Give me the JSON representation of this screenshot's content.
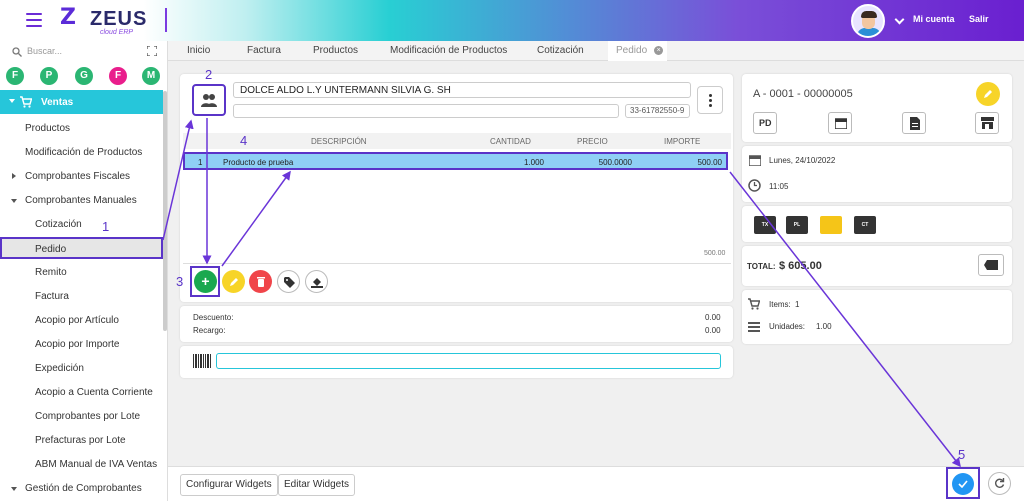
{
  "app": {
    "logo_text": "ZEUS",
    "logo_sub": "cloud ERP",
    "account_label": "Mi cuenta",
    "logout_label": "Salir"
  },
  "sidebar": {
    "search_placeholder": "Buscar...",
    "shortcuts": [
      {
        "letter": "F",
        "color": "#2bb673"
      },
      {
        "letter": "P",
        "color": "#2bb673"
      },
      {
        "letter": "G",
        "color": "#2bb673"
      },
      {
        "letter": "F",
        "color": "#e91e8c"
      },
      {
        "letter": "M",
        "color": "#2bb673"
      }
    ],
    "section_title": "Ventas",
    "items": [
      {
        "label": "Productos"
      },
      {
        "label": "Modificación de Productos"
      },
      {
        "label": "Comprobantes Fiscales"
      },
      {
        "label": "Comprobantes Manuales"
      },
      {
        "label": "Cotización"
      },
      {
        "label": "Pedido"
      },
      {
        "label": "Remito"
      },
      {
        "label": "Factura"
      },
      {
        "label": "Acopio por Artículo"
      },
      {
        "label": "Acopio por Importe"
      },
      {
        "label": "Expedición"
      },
      {
        "label": "Acopio a Cuenta Corriente"
      },
      {
        "label": "Comprobantes por Lote"
      },
      {
        "label": "Prefacturas por Lote"
      },
      {
        "label": "ABM Manual de IVA Ventas"
      },
      {
        "label": "Gestión de Comprobantes"
      }
    ]
  },
  "tabs": [
    {
      "label": "Inicio"
    },
    {
      "label": "Factura"
    },
    {
      "label": "Productos"
    },
    {
      "label": "Modificación de Productos"
    },
    {
      "label": "Cotización"
    },
    {
      "label": "Pedido"
    }
  ],
  "client": {
    "name": "DOLCE ALDO L.Y UNTERMANN SILVIA G. SH",
    "cuit": "33-61782550-9"
  },
  "table": {
    "headers": [
      "DESCRIPCIÓN",
      "CANTIDAD",
      "PRECIO",
      "IMPORTE"
    ],
    "rows": [
      {
        "n": "1",
        "desc": "Producto de prueba",
        "qty": "1.000",
        "price": "500.0000",
        "amount": "500.00"
      }
    ],
    "subtotal": "500.00"
  },
  "totals": {
    "descuento_label": "Descuento:",
    "descuento_value": "0.00",
    "recargo_label": "Recargo:",
    "recargo_value": "0.00"
  },
  "doc": {
    "number": "A - 0001 - 00000005",
    "type_code": "PD",
    "date": "Lunes, 24/10/2022",
    "time": "11:05",
    "total_label": "TOTAL:",
    "total_value": "$ 605.00",
    "items_label": "Items:",
    "items_value": "1",
    "units_label": "Unidades:",
    "units_value": "1.00",
    "mini_icons": [
      "TX",
      "PL",
      "",
      "CT"
    ]
  },
  "annotations": [
    "1",
    "2",
    "3",
    "4",
    "5"
  ],
  "footer": {
    "config_label": "Configurar Widgets",
    "edit_label": "Editar Widgets"
  }
}
